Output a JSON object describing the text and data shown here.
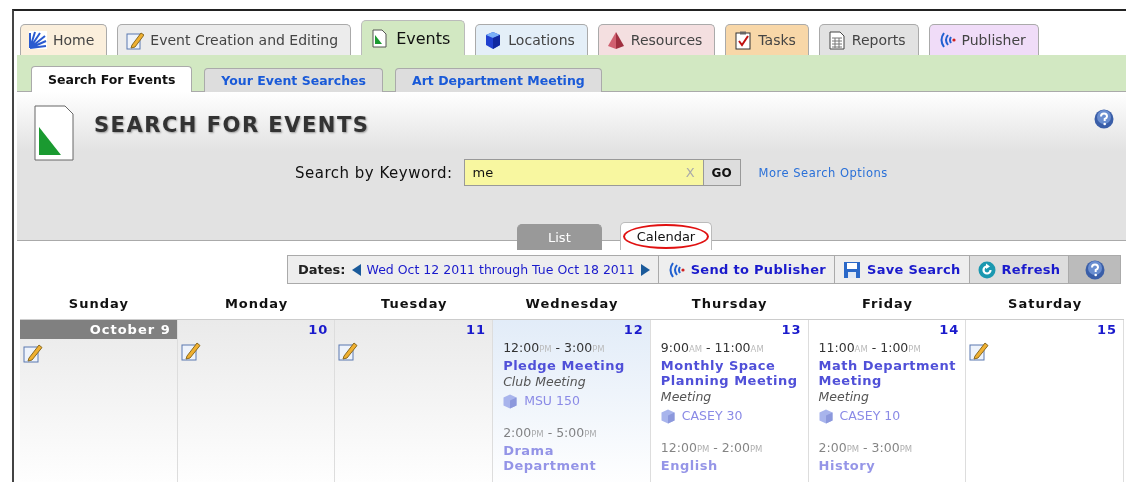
{
  "main_tabs": [
    {
      "label": "Home",
      "kind": "home",
      "color": "#fbefdc",
      "selected": false
    },
    {
      "label": "Event Creation and Editing",
      "kind": "edit",
      "color": "#ececec",
      "selected": false
    },
    {
      "label": "Events",
      "kind": "events",
      "color": "#d2e8c2",
      "selected": true
    },
    {
      "label": "Locations",
      "kind": "locations",
      "color": "#e4eff8",
      "selected": false
    },
    {
      "label": "Resources",
      "kind": "resources",
      "color": "#f4dfe0",
      "selected": false
    },
    {
      "label": "Tasks",
      "kind": "tasks",
      "color": "#f8d7a8",
      "selected": false
    },
    {
      "label": "Reports",
      "kind": "reports",
      "color": "#e2e2e2",
      "selected": false
    },
    {
      "label": "Publisher",
      "kind": "publisher",
      "color": "#f0dcf8",
      "selected": false
    }
  ],
  "sub_tabs": [
    {
      "label": "Search For Events",
      "selected": true
    },
    {
      "label": "Your Event Searches",
      "selected": false
    },
    {
      "label": "Art Department Meeting",
      "selected": false
    }
  ],
  "header": {
    "title": "SEARCH FOR EVENTS",
    "search_label": "Search by Keyword:",
    "search_value": "me",
    "clear": "X",
    "go": "GO",
    "more_link": "More Search Options"
  },
  "view_tabs": [
    {
      "label": "List",
      "selected": false,
      "circled": false
    },
    {
      "label": "Calendar",
      "selected": true,
      "circled": true
    }
  ],
  "toolbar": {
    "dates_label": "Dates:",
    "date_range": "Wed Oct 12 2011 through Tue Oct 18 2011",
    "buttons": [
      {
        "label": "Send to Publisher",
        "kind": "publish"
      },
      {
        "label": "Save Search",
        "kind": "save"
      },
      {
        "label": "Refresh",
        "kind": "refresh"
      }
    ]
  },
  "calendar": {
    "weekdays": [
      "Sunday",
      "Monday",
      "Tuesday",
      "Wednesday",
      "Thursday",
      "Friday",
      "Saturday"
    ],
    "days": [
      {
        "date": "October 9",
        "kind": "past",
        "month_label": true
      },
      {
        "date": "10",
        "kind": "past",
        "month_label": false
      },
      {
        "date": "11",
        "kind": "past",
        "month_label": false
      },
      {
        "date": "12",
        "kind": "today",
        "month_label": false,
        "events": [
          {
            "time": [
              "12:00",
              "PM",
              "-",
              "3:00",
              "PM"
            ],
            "title": "Pledge Meeting",
            "type": "Club Meeting",
            "location": "MSU 150",
            "faded": false
          },
          {
            "time": [
              "2:00",
              "PM",
              "-",
              "5:00",
              "PM"
            ],
            "title": "Drama Department",
            "faded": true
          }
        ]
      },
      {
        "date": "13",
        "kind": "future",
        "month_label": false,
        "events": [
          {
            "time": [
              "9:00",
              "AM",
              "-",
              "11:00",
              "AM"
            ],
            "title": "Monthly Space Planning Meeting",
            "type": "Meeting",
            "location": "CASEY 30",
            "faded": false
          },
          {
            "time": [
              "12:00",
              "PM",
              "-",
              "2:00",
              "PM"
            ],
            "title": "English",
            "faded": true
          }
        ]
      },
      {
        "date": "14",
        "kind": "future",
        "month_label": false,
        "events": [
          {
            "time": [
              "11:00",
              "AM",
              "-",
              "1:00",
              "PM"
            ],
            "title": "Math Department Meeting",
            "type": "Meeting",
            "location": "CASEY 10",
            "faded": false
          },
          {
            "time": [
              "2:00",
              "PM",
              "-",
              "3:00",
              "PM"
            ],
            "title": "History",
            "faded": true
          }
        ]
      },
      {
        "date": "15",
        "kind": "future",
        "month_label": false
      }
    ]
  }
}
